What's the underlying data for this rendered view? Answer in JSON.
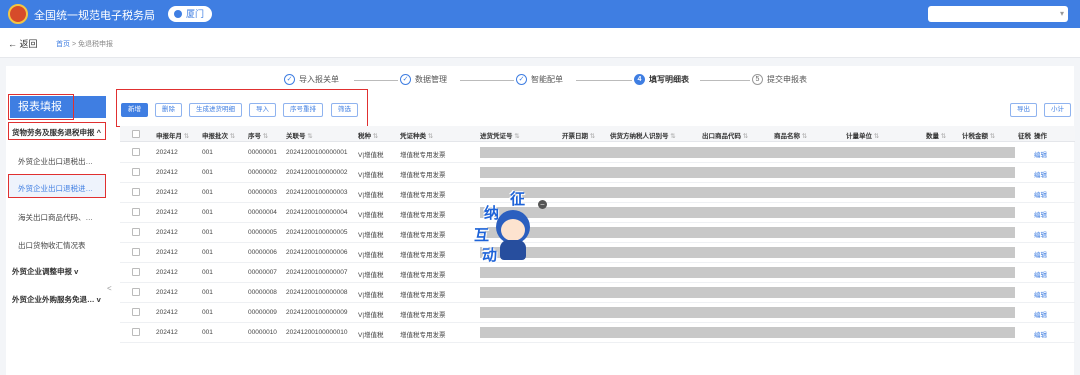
{
  "header": {
    "title": "全国统一规范电子税务局",
    "city": "厦门"
  },
  "breadcrumb": {
    "back": "返回",
    "home": "首页",
    "separator": ">",
    "current": "免退税申报"
  },
  "steps": [
    {
      "label": "导入报关单",
      "state": "done"
    },
    {
      "label": "数据管理",
      "state": "done"
    },
    {
      "label": "智能配单",
      "state": "done"
    },
    {
      "label": "填写明细表",
      "state": "active",
      "num": "4"
    },
    {
      "label": "提交申报表",
      "state": "todo",
      "num": "5"
    }
  ],
  "sidebar": {
    "title": "报表填报",
    "groups": [
      {
        "label": "货物劳务及服务退税申报",
        "chevron": "^"
      },
      {
        "label": "外贸企业调整申报",
        "chevron": "v"
      },
      {
        "label": "外贸企业外购服务免退…",
        "chevron": "v"
      }
    ],
    "items": [
      "外贸企业出口退税出…",
      "外贸企业出口退税进…",
      "海关出口商品代码、…",
      "出口货物收汇情况表"
    ],
    "collapse": "<"
  },
  "toolbar": {
    "buttons": [
      "新增",
      "删除",
      "生成进货明细",
      "导入",
      "序号重排",
      "筛选"
    ],
    "right": [
      "导出",
      "小计"
    ]
  },
  "table": {
    "columns": [
      "申报年月",
      "申报批次",
      "序号",
      "关联号",
      "税种",
      "凭证种类",
      "进货凭证号",
      "开票日期",
      "供货方纳税人识别号",
      "出口商品代码",
      "商品名称",
      "计量单位",
      "数量",
      "计税金额",
      "征税",
      "操作"
    ],
    "rows": [
      [
        "202412",
        "001",
        "00000001",
        "20241200100000001",
        "V|增值税",
        "增值税专用发票"
      ],
      [
        "202412",
        "001",
        "00000002",
        "20241200100000002",
        "V|增值税",
        "增值税专用发票"
      ],
      [
        "202412",
        "001",
        "00000003",
        "20241200100000003",
        "V|增值税",
        "增值税专用发票"
      ],
      [
        "202412",
        "001",
        "00000004",
        "20241200100000004",
        "V|增值税",
        "增值税专用发票"
      ],
      [
        "202412",
        "001",
        "00000005",
        "20241200100000005",
        "V|增值税",
        "增值税专用发票"
      ],
      [
        "202412",
        "001",
        "00000006",
        "20241200100000006",
        "V|增值税",
        "增值税专用发票"
      ],
      [
        "202412",
        "001",
        "00000007",
        "20241200100000007",
        "V|增值税",
        "增值税专用发票"
      ],
      [
        "202412",
        "001",
        "00000008",
        "20241200100000008",
        "V|增值税",
        "增值税专用发票"
      ],
      [
        "202412",
        "001",
        "00000009",
        "20241200100000009",
        "V|增值税",
        "增值税专用发票"
      ],
      [
        "202412",
        "001",
        "00000010",
        "20241200100000010",
        "V|增值税",
        "增值税专用发票"
      ]
    ],
    "action": "编辑"
  },
  "mascot": {
    "chars": [
      "征",
      "纳",
      "互",
      "动"
    ]
  }
}
